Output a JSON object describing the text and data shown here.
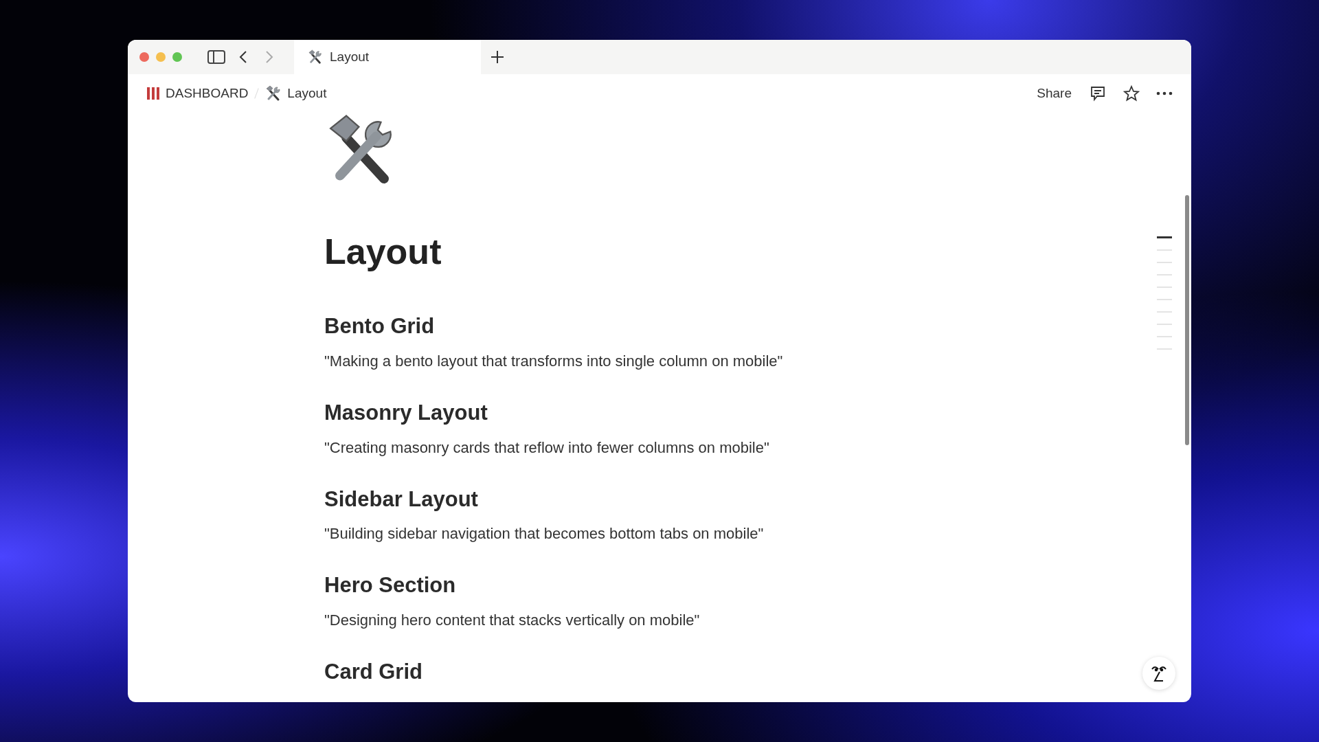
{
  "tab": {
    "label": "Layout",
    "selected": true
  },
  "breadcrumb": [
    {
      "label": "DASHBOARD",
      "kind": "books"
    },
    {
      "label": "Layout",
      "kind": "tools"
    }
  ],
  "topbar": {
    "share": "Share"
  },
  "page": {
    "title": "Layout"
  },
  "sections": [
    {
      "heading": "Bento Grid",
      "text": "\"Making a bento layout that transforms into single column on mobile\""
    },
    {
      "heading": "Masonry Layout",
      "text": "\"Creating masonry cards that reflow into fewer columns on mobile\""
    },
    {
      "heading": "Sidebar Layout",
      "text": "\"Building sidebar navigation that becomes bottom tabs on mobile\""
    },
    {
      "heading": "Hero Section",
      "text": "\"Designing hero content that stacks vertically on mobile\""
    },
    {
      "heading": "Card Grid"
    }
  ],
  "outline": [
    {
      "selected": true
    },
    {
      "selected": false
    },
    {
      "selected": false
    },
    {
      "selected": false
    },
    {
      "selected": false
    },
    {
      "selected": false
    },
    {
      "selected": false
    },
    {
      "selected": false
    },
    {
      "selected": false
    },
    {
      "selected": false
    }
  ]
}
